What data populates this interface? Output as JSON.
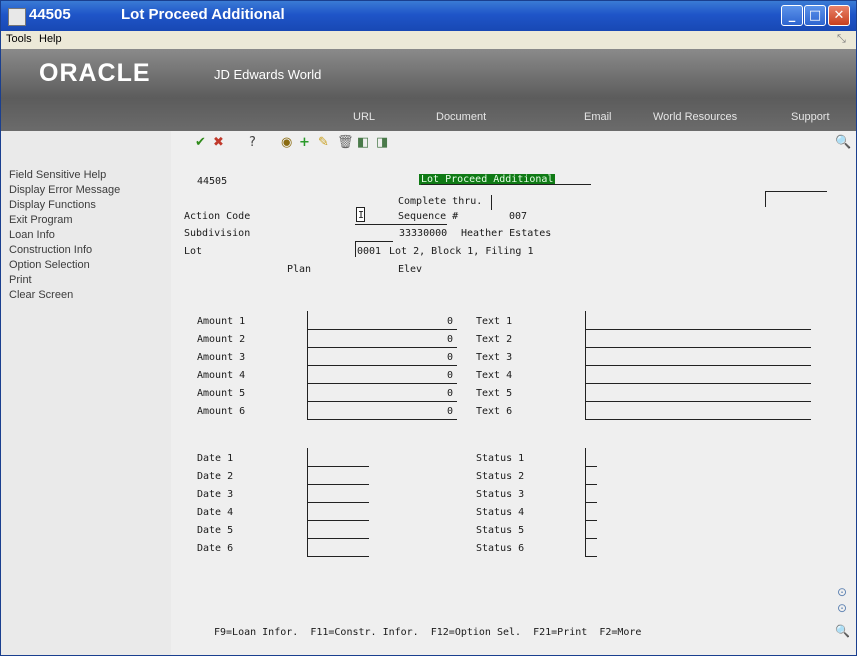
{
  "window": {
    "program_number": "44505",
    "title": "Lot Proceed Additional"
  },
  "menu": {
    "tools": "Tools",
    "help": "Help"
  },
  "banner": {
    "logo_text": "ORACLE",
    "product": "JD Edwards World",
    "links": {
      "url": "URL",
      "document": "Document",
      "email": "Email",
      "world_resources": "World Resources",
      "support": "Support"
    }
  },
  "left_menu": [
    "Field Sensitive Help",
    "Display Error Message",
    "Display Functions",
    "Exit Program",
    "Loan Info",
    "Construction Info",
    "Option Selection",
    "Print",
    "Clear Screen"
  ],
  "form": {
    "program_id": "44505",
    "screen_title": "Lot Proceed Additional",
    "complete_thru_label": "Complete thru.",
    "action_code_label": "Action Code",
    "action_code_value": "I",
    "sequence_label": "Sequence #",
    "sequence_value": "007",
    "subdivision_label": "Subdivision",
    "subdivision_value": "33330000",
    "subdivision_name": "Heather Estates",
    "lot_label": "Lot",
    "lot_value": "0001",
    "lot_description": "Lot 2, Block 1, Filing 1",
    "plan_label": "Plan",
    "elev_label": "Elev",
    "amounts": [
      {
        "label": "Amount 1",
        "value": "0"
      },
      {
        "label": "Amount 2",
        "value": "0"
      },
      {
        "label": "Amount 3",
        "value": "0"
      },
      {
        "label": "Amount 4",
        "value": "0"
      },
      {
        "label": "Amount 5",
        "value": "0"
      },
      {
        "label": "Amount 6",
        "value": "0"
      }
    ],
    "texts": [
      "Text 1",
      "Text 2",
      "Text 3",
      "Text 4",
      "Text 5",
      "Text 6"
    ],
    "dates": [
      "Date 1",
      "Date 2",
      "Date 3",
      "Date 4",
      "Date 5",
      "Date 6"
    ],
    "statuses": [
      "Status 1",
      "Status 2",
      "Status 3",
      "Status 4",
      "Status 5",
      "Status 6"
    ],
    "function_keys": "F9=Loan Infor.  F11=Constr. Infor.  F12=Option Sel.  F21=Print  F2=More"
  },
  "colors": {
    "title_blue": "#1f55c8",
    "banner_green": "#0f7a15"
  }
}
